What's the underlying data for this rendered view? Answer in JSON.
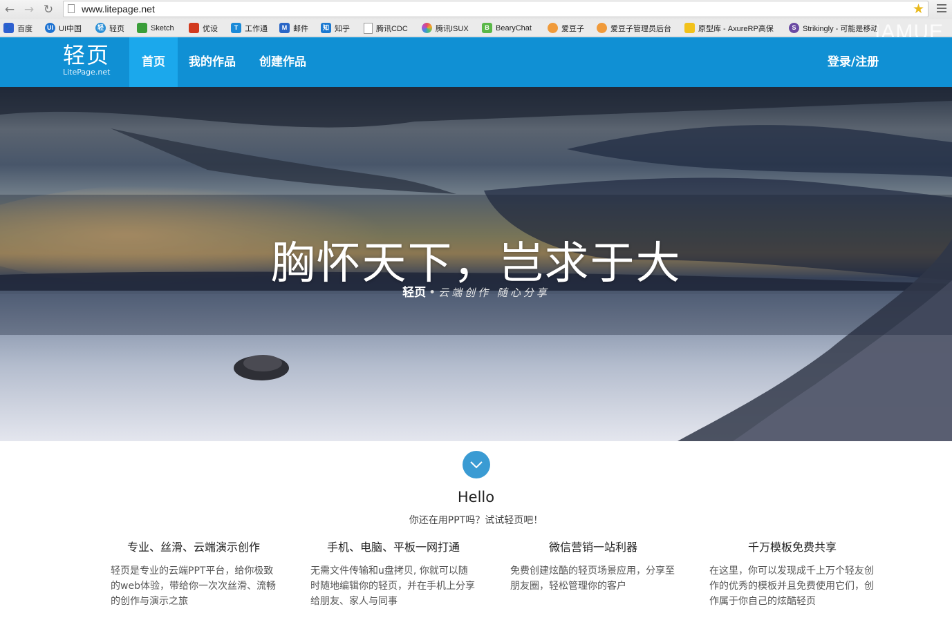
{
  "browser": {
    "url": "www.litepage.net",
    "watermark": "IAMUE",
    "bookmarks": [
      {
        "label": "百度",
        "icon": "baidu-paw-icon",
        "color": "#2f5fd0",
        "glyph": "\u0000"
      },
      {
        "label": "UI中国",
        "icon": "uichina-icon",
        "color": "#1e73d2",
        "glyph": "UI"
      },
      {
        "label": "轻页",
        "icon": "litepage-icon",
        "color": "#2a8fd6",
        "glyph": "轻"
      },
      {
        "label": "Sketch",
        "icon": "sketch-icon",
        "color": "#3a9e3a",
        "glyph": ""
      },
      {
        "label": "优设",
        "icon": "uisdc-icon",
        "color": "#d23a1e",
        "glyph": ""
      },
      {
        "label": "工作通",
        "icon": "gongzuotong-icon",
        "color": "#1a8ad8",
        "glyph": "T"
      },
      {
        "label": "邮件",
        "icon": "mail-icon",
        "color": "#2a66c7",
        "glyph": "M"
      },
      {
        "label": "知乎",
        "icon": "zhihu-icon",
        "color": "#1b79d1",
        "glyph": "知"
      },
      {
        "label": "腾讯CDC",
        "icon": "page-icon",
        "color": "#ffffff",
        "glyph": ""
      },
      {
        "label": "腾讯ISUX",
        "icon": "isux-icon",
        "color": "#b44fd0",
        "glyph": ""
      },
      {
        "label": "BearyChat",
        "icon": "bearychat-icon",
        "color": "#5ab848",
        "glyph": "B"
      },
      {
        "label": "爱豆子",
        "icon": "aidouzi-icon",
        "color": "#f09a3a",
        "glyph": ""
      },
      {
        "label": "爱豆子管理员后台",
        "icon": "aidouzi-admin-icon",
        "color": "#f09a3a",
        "glyph": ""
      },
      {
        "label": "原型库 - AxureRP高保",
        "icon": "axure-icon",
        "color": "#f2c21b",
        "glyph": ""
      },
      {
        "label": "Strikingly - 可能是移动",
        "icon": "strikingly-icon",
        "color": "#6a4aa3",
        "glyph": "S"
      }
    ]
  },
  "header": {
    "logo_main": "轻页",
    "logo_sub": "LitePage.net",
    "nav": [
      {
        "label": "首页",
        "active": true
      },
      {
        "label": "我的作品",
        "active": false
      },
      {
        "label": "创建作品",
        "active": false
      }
    ],
    "login": "登录/注册",
    "color": "#1090d4",
    "active_color": "#1ba8ec"
  },
  "hero": {
    "title": "胸怀天下，岂求于大",
    "brand": "轻页",
    "separator": "•",
    "slogan": "云端创作 随心分享"
  },
  "intro": {
    "hello": "Hello",
    "tagline": "你还在用PPT吗？试试轻页吧！"
  },
  "features": [
    {
      "title": "专业、丝滑、云端演示创作",
      "desc": "轻页是专业的云端PPT平台，给你极致的web体验，带给你一次次丝滑、流畅的创作与演示之旅"
    },
    {
      "title": "手机、电脑、平板一网打通",
      "desc": "无需文件传输和u盘拷贝, 你就可以随时随地编辑你的轻页，并在手机上分享给朋友、家人与同事"
    },
    {
      "title": "微信营销一站利器",
      "desc": "免费创建炫酷的轻页场景应用，分享至朋友圈，轻松管理你的客户"
    },
    {
      "title": "千万模板免费共享",
      "desc": "在这里，你可以发现成千上万个轻友创作的优秀的模板并且免费使用它们，创作属于你自己的炫酷轻页"
    }
  ]
}
